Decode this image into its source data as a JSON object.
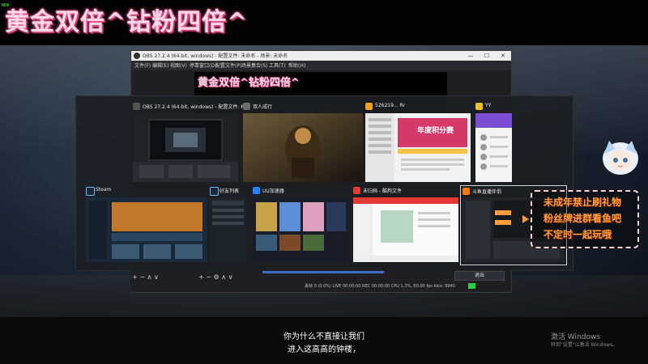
{
  "overlay": {
    "title": "黄金双倍^钻粉四倍^",
    "corner_tag": "NEW",
    "preview_title": "黄金双倍^钻粉四倍^"
  },
  "obs_window": {
    "title": "OBS 27.2.4 (64-bit, windows) - 配置文件: 未命名 - 场景: 未命名",
    "menu": [
      "文件(F)",
      "编辑(E)",
      "视图(V)",
      "停靠窗口(D)",
      "配置文件(P)",
      "场景集合(S)",
      "工具(T)",
      "帮助(H)"
    ],
    "window_controls": [
      "—",
      "☐",
      "✕"
    ],
    "status": "丢帧 0 (0.0%)   LIVE 00:00:00   REC 00:00:00   CPU 1.3%, 60.00 fps   kb/s: 9940",
    "bottom_left_controls": "+ − ∧ ∨",
    "bottom_mid_controls": "+ − ⚙ ∧ ∨",
    "exit_button": "退出"
  },
  "taskview": {
    "windows": [
      {
        "label": "OBS 27.2.4 (64-bit, windows) - 配置文件: R...",
        "icon": "obs-icon",
        "icon_color": "#555555"
      },
      {
        "label": "双人成行",
        "icon": "game-icon",
        "icon_color": "#6a6a6a"
      },
      {
        "label": "526219...  Rr",
        "icon": "chat-icon",
        "icon_color": "#f0a020"
      },
      {
        "label": "YY",
        "icon": "yy-icon",
        "icon_color": "#f0c020"
      },
      {
        "label": "Steam",
        "icon": "steam-icon",
        "icon_color": "#1b2838"
      },
      {
        "label": "好友列表",
        "icon": "steam-icon",
        "icon_color": "#1b2838"
      },
      {
        "label": "UU加速器",
        "icon": "uu-icon",
        "icon_color": "#2a7fff"
      },
      {
        "label": "未归档 - 酷狗文件",
        "icon": "music-icon",
        "icon_color": "#e53935"
      },
      {
        "label": "斗鱼直播伴侣",
        "icon": "douyu-icon",
        "icon_color": "#ff7a00"
      }
    ],
    "promo_card_badge": "年度积分赛"
  },
  "promo": {
    "lines": [
      "未成年禁止刷礼物",
      "粉丝牌进群看鱼吧",
      "不定时一起玩哦"
    ]
  },
  "subtitles": {
    "line1": "你为什么不直接让我们",
    "line2": "进入这高高的钟楼，"
  },
  "watermark": {
    "line1": "激活 Windows",
    "line2": "转到\"设置\"以激活 Windows。"
  },
  "colors": {
    "accent_pink": "#ff4d8d",
    "promo_orange": "#ff9c3a",
    "obs_dark": "#1f1f22"
  }
}
